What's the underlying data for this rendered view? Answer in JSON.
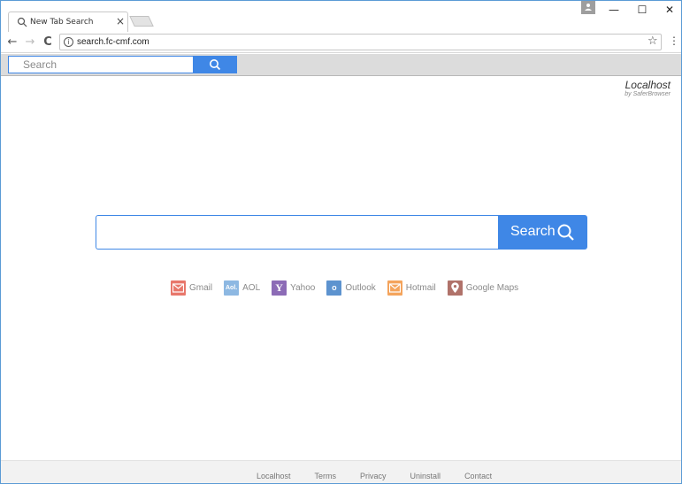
{
  "browser": {
    "tab_title": "New Tab Search",
    "tab_close": "×",
    "url": "search.fc-cmf.com",
    "window_controls": {
      "minimize": "—",
      "maximize": "☐",
      "close": "✕"
    },
    "nav": {
      "back": "←",
      "forward": "→",
      "reload": "C"
    },
    "bookmark_star": "☆",
    "menu": "⋮",
    "info": "i"
  },
  "extension_bar": {
    "search_placeholder": "Search",
    "accent_color": "#3f87e6"
  },
  "brand": {
    "name": "Localhost",
    "subtitle": "by SaferBrowser"
  },
  "main_search": {
    "button_label": "Search",
    "value": ""
  },
  "shortcuts": [
    {
      "label": "Gmail",
      "icon": "mail-icon",
      "color": "#e8776b"
    },
    {
      "label": "AOL",
      "icon": "aol-icon",
      "color": "#8db8e2"
    },
    {
      "label": "Yahoo",
      "icon": "yahoo-icon",
      "color": "#8c6bb6"
    },
    {
      "label": "Outlook",
      "icon": "outlook-icon",
      "color": "#5d93cf"
    },
    {
      "label": "Hotmail",
      "icon": "mail-icon",
      "color": "#f4a45c"
    },
    {
      "label": "Google Maps",
      "icon": "map-pin-icon",
      "color": "#b0726a"
    }
  ],
  "shortcut_glyphs": {
    "aol": "Aol.",
    "yahoo": "Y",
    "outlook": "o"
  },
  "footer": {
    "links": [
      "Localhost",
      "Terms",
      "Privacy",
      "Uninstall",
      "Contact"
    ]
  }
}
